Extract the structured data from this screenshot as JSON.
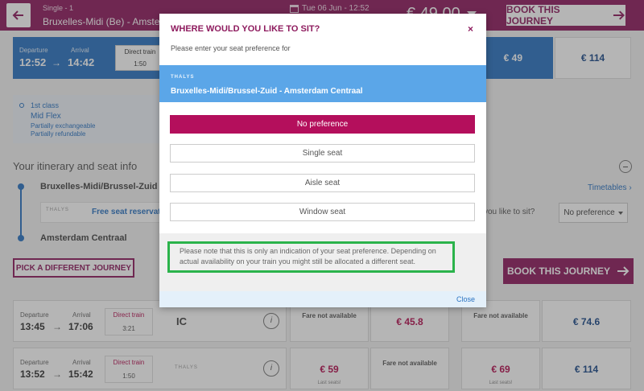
{
  "header": {
    "trip_type": "Single - 1",
    "route": "Bruxelles-Midi (Be) - Amsterdam",
    "date": "Tue 06 Jun - 12:52",
    "price": "€ 49.00",
    "book_label": "BOOK THIS JOURNEY"
  },
  "selected_journey": {
    "departure_label": "Departure",
    "arrival_label": "Arrival",
    "departure_time": "12:52",
    "arrival_time": "14:42",
    "direct_label": "Direct train",
    "duration": "1:50",
    "price_1": "€ 49",
    "price_2": "€ 114"
  },
  "fare_info": {
    "class": "1st class",
    "fare_name": "Mid Flex",
    "policy_1": "Partially exchangeable",
    "policy_2": "Partially refundable"
  },
  "itinerary": {
    "title": "Your itinerary and seat info",
    "from": "Bruxelles-Midi/Brussel-Zuid",
    "to": "Amsterdam Centraal",
    "timetables": "Timetables",
    "operator_logo": "THALYS",
    "free_seat": "Free seat reservation",
    "seat_question": "you like to sit?",
    "seat_select": "No preference",
    "pick_label": "PICK A DIFFERENT JOURNEY",
    "book_label": "BOOK THIS JOURNEY"
  },
  "journeys": [
    {
      "departure_label": "Departure",
      "arrival_label": "Arrival",
      "departure_time": "13:45",
      "arrival_time": "17:06",
      "direct_label": "Direct train",
      "duration": "3:21",
      "operator": "IC",
      "c1": "Fare not available",
      "c2": "€ 45.8",
      "c3": "Fare not available",
      "c4": "€ 74.6"
    },
    {
      "departure_label": "Departure",
      "arrival_label": "Arrival",
      "departure_time": "13:52",
      "arrival_time": "15:42",
      "direct_label": "Direct train",
      "duration": "1:50",
      "operator": "THALYS",
      "c1": "€ 59",
      "c1_note": "Last seats!",
      "c2": "Fare not available",
      "c3": "€ 69",
      "c3_note": "Last seats!",
      "c4": "€ 114"
    }
  ],
  "modal": {
    "title": "WHERE WOULD YOU LIKE TO SIT?",
    "close_x": "×",
    "subtitle": "Please enter your seat preference for",
    "operator_logo": "THALYS",
    "route": "Bruxelles-Midi/Brussel-Zuid - Amsterdam Centraal",
    "options": [
      "No preference",
      "Single seat",
      "Aisle seat",
      "Window seat"
    ],
    "note_line1": "Please note that this is only an indication of your seat preference. Depending on",
    "note_line2": "actual availability on your train you might still be allocated a different seat.",
    "close_label": "Close"
  },
  "colors": {
    "brand": "#8e1b5e",
    "accent_blue": "#2a73c2",
    "active_option": "#b40f5c",
    "note_border": "#2bb34b"
  }
}
